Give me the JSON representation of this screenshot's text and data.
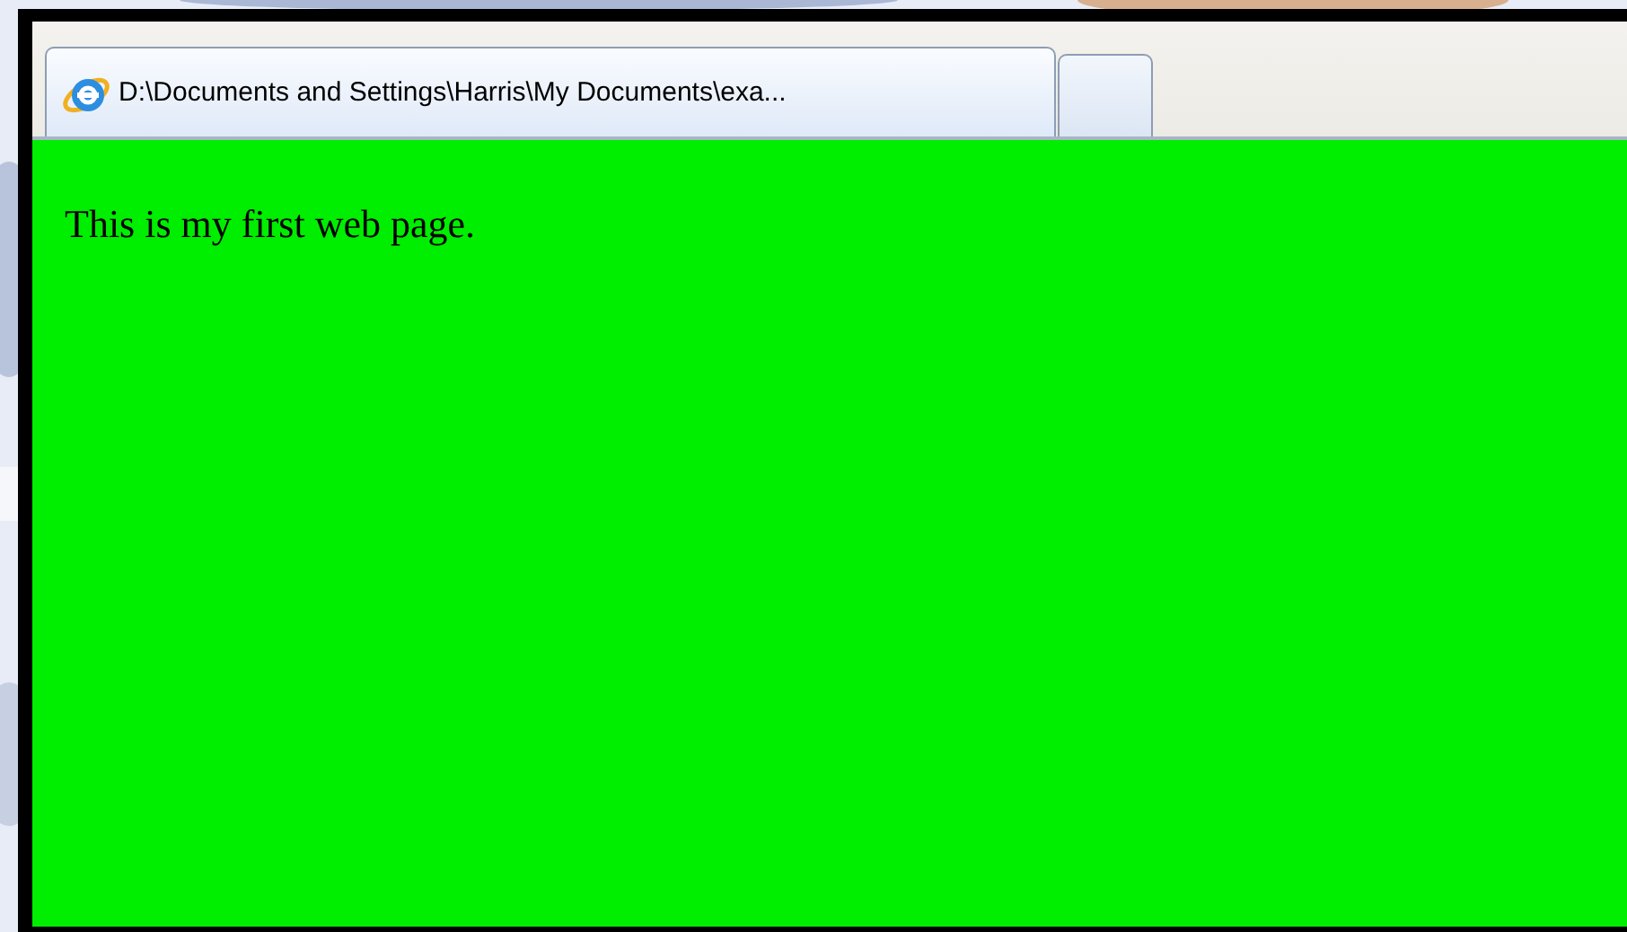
{
  "browser": {
    "tabs": [
      {
        "title": "D:\\Documents and Settings\\Harris\\My Documents\\exa...",
        "selected": true
      }
    ],
    "page": {
      "text": "This is my first web page."
    }
  }
}
